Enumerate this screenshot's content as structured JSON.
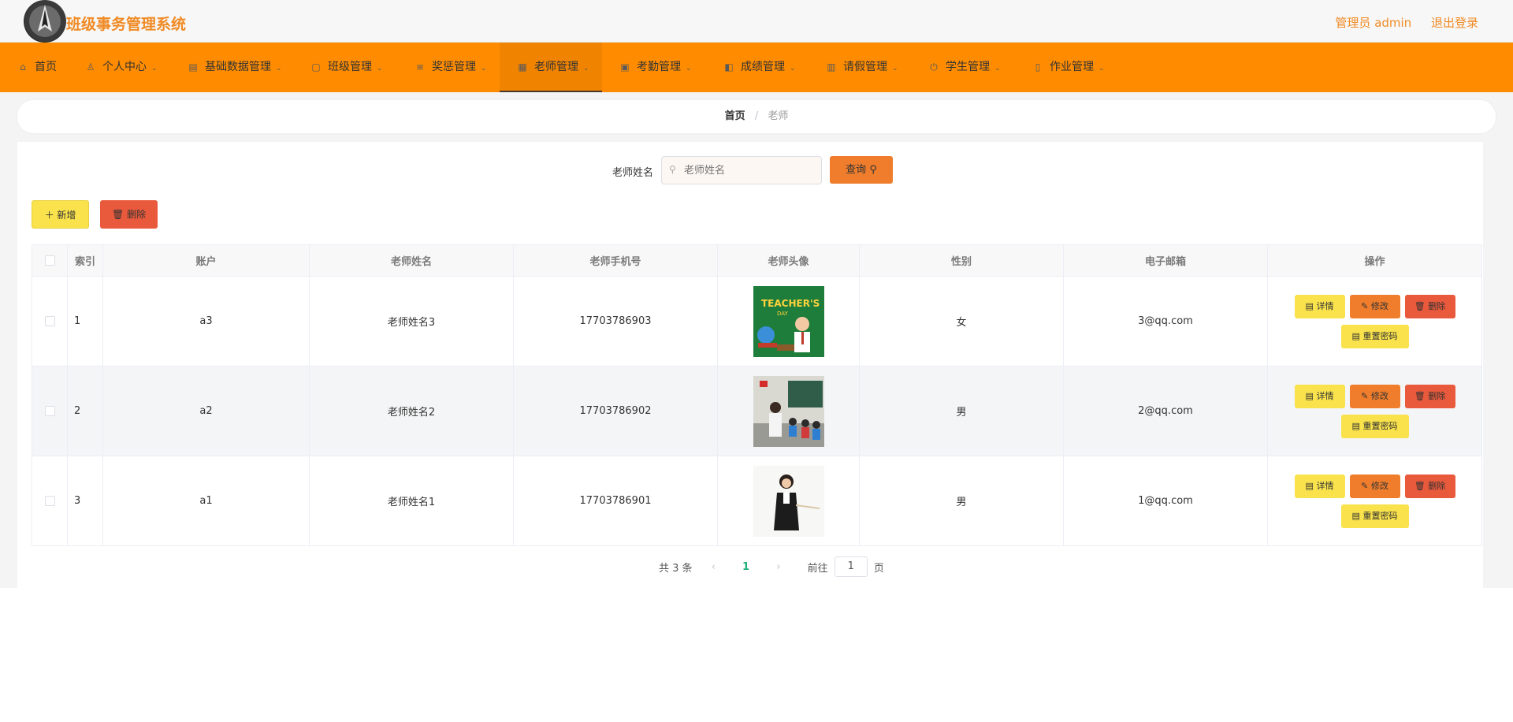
{
  "header": {
    "app_title": "班级事务管理系统",
    "user_label": "管理员 admin",
    "logout_label": "退出登录"
  },
  "nav": {
    "items": [
      {
        "label": "首页",
        "icon": "home-icon"
      },
      {
        "label": "个人中心",
        "icon": "user-icon"
      },
      {
        "label": "基础数据管理",
        "icon": "database-icon"
      },
      {
        "label": "班级管理",
        "icon": "calendar-icon"
      },
      {
        "label": "奖惩管理",
        "icon": "sliders-icon"
      },
      {
        "label": "老师管理",
        "icon": "grid-icon"
      },
      {
        "label": "考勤管理",
        "icon": "clipboard-icon"
      },
      {
        "label": "成绩管理",
        "icon": "briefcase-icon"
      },
      {
        "label": "请假管理",
        "icon": "form-icon"
      },
      {
        "label": "学生管理",
        "icon": "power-icon"
      },
      {
        "label": "作业管理",
        "icon": "file-icon"
      }
    ],
    "active_index": 5,
    "accent_color": "#ff8c00"
  },
  "breadcrumb": {
    "home": "首页",
    "separator": "/",
    "current": "老师"
  },
  "search": {
    "label": "老师姓名",
    "placeholder": "老师姓名",
    "button_label": "查询"
  },
  "toolbar": {
    "add_label": "新增",
    "delete_label": "删除"
  },
  "table": {
    "columns": [
      "索引",
      "账户",
      "老师姓名",
      "老师手机号",
      "老师头像",
      "性别",
      "电子邮箱",
      "操作"
    ],
    "rows": [
      {
        "index": "1",
        "account": "a3",
        "name": "老师姓名3",
        "phone": "17703786903",
        "avatar": "teachers-day-illustration",
        "gender": "女",
        "email": "3@qq.com"
      },
      {
        "index": "2",
        "account": "a2",
        "name": "老师姓名2",
        "phone": "17703786902",
        "avatar": "classroom-photo",
        "gender": "男",
        "email": "2@qq.com"
      },
      {
        "index": "3",
        "account": "a1",
        "name": "老师姓名1",
        "phone": "17703786901",
        "avatar": "teacher-portrait-photo",
        "gender": "男",
        "email": "1@qq.com"
      }
    ],
    "row_actions": {
      "detail": "详情",
      "edit": "修改",
      "delete": "删除",
      "reset_password": "重置密码"
    }
  },
  "pagination": {
    "total_text": "共 3 条",
    "current_page": "1",
    "goto_prefix": "前往",
    "goto_value": "1",
    "goto_suffix": "页"
  }
}
